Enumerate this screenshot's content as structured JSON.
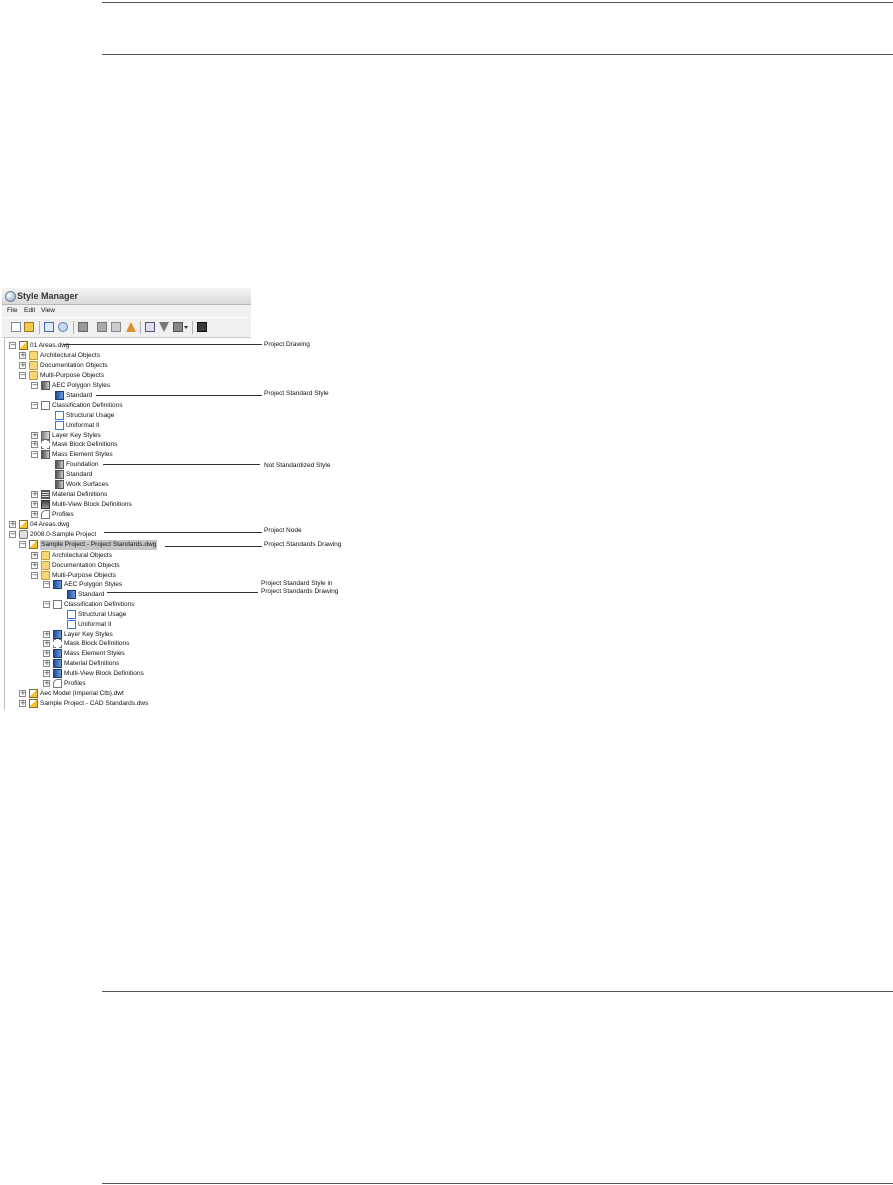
{
  "window": {
    "title": "Style Manager"
  },
  "menu": {
    "file": "File",
    "edit": "Edit",
    "view": "View"
  },
  "toolbar": {
    "buttons": [
      "new-icon",
      "open-icon",
      "copy-icon",
      "paste-icon",
      "purge-icon",
      "edit-style-icon",
      "sort-icon",
      "text-style-icon",
      "toggle-view-icon",
      "filter-icon",
      "display-icon",
      "help-icon"
    ]
  },
  "tree": {
    "items": [
      {
        "label": "01 Areas.dwg",
        "icon": "drawing"
      },
      {
        "label": "Architectural Objects",
        "icon": "folder"
      },
      {
        "label": "Documentation Objects",
        "icon": "folder"
      },
      {
        "label": "Multi-Purpose Objects",
        "icon": "folder"
      },
      {
        "label": "AEC Polygon Styles",
        "icon": "gray"
      },
      {
        "label": "Standard",
        "icon": "blue"
      },
      {
        "label": "Classification Definitions",
        "icon": "class"
      },
      {
        "label": "Structural Usage",
        "icon": "classitem"
      },
      {
        "label": "Uniformat II",
        "icon": "classitem"
      },
      {
        "label": "Layer Key Styles",
        "icon": "layerkey"
      },
      {
        "label": "Mask Block Definitions",
        "icon": "mask"
      },
      {
        "label": "Mass Element Styles",
        "icon": "gray"
      },
      {
        "label": "Foundation",
        "icon": "gray"
      },
      {
        "label": "Standard",
        "icon": "gray"
      },
      {
        "label": "Work Surfaces",
        "icon": "gray"
      },
      {
        "label": "Material Definitions",
        "icon": "material"
      },
      {
        "label": "Multi-View Block Definitions",
        "icon": "mview"
      },
      {
        "label": "Profiles",
        "icon": "profile"
      },
      {
        "label": "04 Areas.dwg",
        "icon": "drawing"
      },
      {
        "label": "2008.0-Sample Project",
        "icon": "project"
      },
      {
        "label": "Sample Project - Project Standards.dwg",
        "icon": "drawing"
      },
      {
        "label": "Architectural Objects",
        "icon": "folder"
      },
      {
        "label": "Documentation Objects",
        "icon": "folder"
      },
      {
        "label": "Multi-Purpose Objects",
        "icon": "folder"
      },
      {
        "label": "AEC Polygon Styles",
        "icon": "blue"
      },
      {
        "label": "Standard",
        "icon": "blue"
      },
      {
        "label": "Classification Definitions",
        "icon": "class"
      },
      {
        "label": "Structural Usage",
        "icon": "classitem"
      },
      {
        "label": "Uniformat II",
        "icon": "classitem"
      },
      {
        "label": "Layer Key Styles",
        "icon": "blue"
      },
      {
        "label": "Mask Block Definitions",
        "icon": "mask"
      },
      {
        "label": "Mass Element Styles",
        "icon": "blue"
      },
      {
        "label": "Material Definitions",
        "icon": "blue"
      },
      {
        "label": "Multi-View Block Definitions",
        "icon": "blue"
      },
      {
        "label": "Profiles",
        "icon": "profile"
      },
      {
        "label": "Aec Model (Imperial Ctb).dwt",
        "icon": "drawing"
      },
      {
        "label": "Sample Project - CAD Standards.dws",
        "icon": "drawing"
      }
    ]
  },
  "callouts": {
    "project_drawing": "Project Drawing",
    "project_standard_style": "Project Standard Style",
    "not_standardized_style": "Not Standardized Style",
    "project_node": "Project Node",
    "project_standards_drawing": "Project Standards Drawing",
    "project_standard_style_in_1": "Project Standard Style in",
    "project_standard_style_in_2": "Project Standards Drawing"
  }
}
